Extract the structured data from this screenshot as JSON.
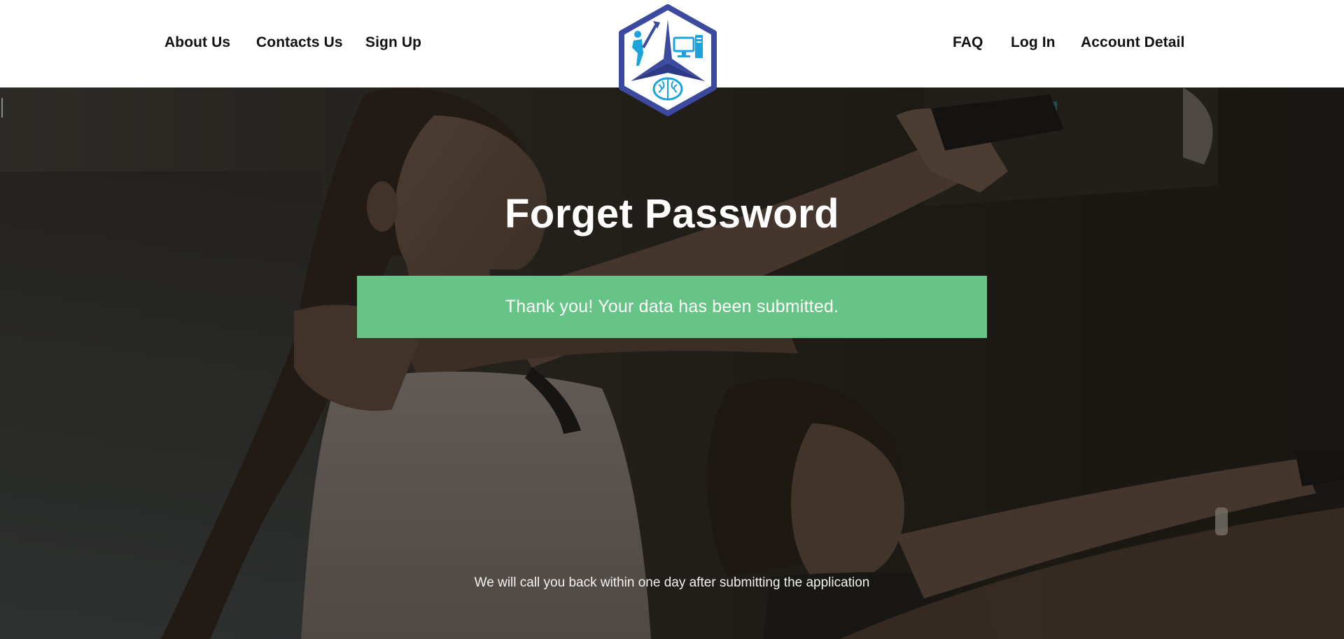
{
  "header": {
    "left_nav": [
      {
        "label": "About Us"
      },
      {
        "label": "Contacts Us"
      },
      {
        "label": "Sign Up"
      }
    ],
    "right_nav": [
      {
        "label": "FAQ"
      },
      {
        "label": "Log In"
      },
      {
        "label": "Account Detail"
      }
    ],
    "logo_icon": "hexagon-logo-icon"
  },
  "main": {
    "title": "Forget Password",
    "success_message": "Thank you! Your data has been submitted.",
    "callback_note": "We will call you back within one day after submitting the application"
  },
  "colors": {
    "header_bg": "#ffffff",
    "success_bg": "#66c586",
    "logo_border": "#3b4a9e",
    "logo_accent": "#1ba3dd"
  }
}
